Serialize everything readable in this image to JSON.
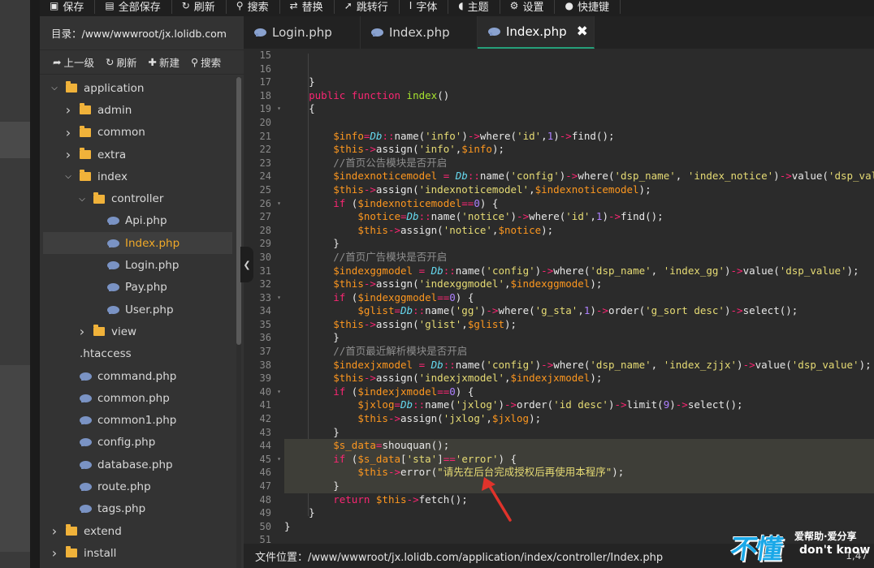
{
  "toolbar": {
    "buttons": [
      {
        "label": "保存",
        "icon": "save-icon"
      },
      {
        "label": "全部保存",
        "icon": "save-all-icon"
      },
      {
        "label": "刷新",
        "icon": "refresh-icon"
      },
      {
        "label": "搜索",
        "icon": "search-icon"
      },
      {
        "label": "替换",
        "icon": "replace-icon"
      },
      {
        "label": "跳转行",
        "icon": "goto-line-icon"
      },
      {
        "label": "字体",
        "icon": "font-icon"
      },
      {
        "label": "主题",
        "icon": "theme-icon"
      },
      {
        "label": "设置",
        "icon": "gear-icon"
      },
      {
        "label": "快捷键",
        "icon": "help-icon"
      }
    ]
  },
  "sidebar": {
    "directory": "目录：/www/wwwroot/jx.lolidb.com",
    "actions": {
      "up": "上一级",
      "refresh": "刷新",
      "new": "新建",
      "search": "搜索"
    },
    "tree": [
      {
        "label": "application",
        "type": "folder",
        "depth": 0,
        "open": true
      },
      {
        "label": "admin",
        "type": "folder",
        "depth": 1,
        "open": false
      },
      {
        "label": "common",
        "type": "folder",
        "depth": 1,
        "open": false
      },
      {
        "label": "extra",
        "type": "folder",
        "depth": 1,
        "open": false
      },
      {
        "label": "index",
        "type": "folder",
        "depth": 1,
        "open": true
      },
      {
        "label": "controller",
        "type": "folder",
        "depth": 2,
        "open": true
      },
      {
        "label": "Api.php",
        "type": "php",
        "depth": 3
      },
      {
        "label": "Index.php",
        "type": "php",
        "depth": 3,
        "selected": true
      },
      {
        "label": "Login.php",
        "type": "php",
        "depth": 3
      },
      {
        "label": "Pay.php",
        "type": "php",
        "depth": 3
      },
      {
        "label": "User.php",
        "type": "php",
        "depth": 3
      },
      {
        "label": "view",
        "type": "folder",
        "depth": 2,
        "open": false
      },
      {
        "label": ".htaccess",
        "type": "file",
        "depth": 1
      },
      {
        "label": "command.php",
        "type": "php",
        "depth": 1
      },
      {
        "label": "common.php",
        "type": "php",
        "depth": 1
      },
      {
        "label": "common1.php",
        "type": "php",
        "depth": 1
      },
      {
        "label": "config.php",
        "type": "php",
        "depth": 1
      },
      {
        "label": "database.php",
        "type": "php",
        "depth": 1
      },
      {
        "label": "route.php",
        "type": "php",
        "depth": 1
      },
      {
        "label": "tags.php",
        "type": "php",
        "depth": 1
      },
      {
        "label": "extend",
        "type": "folder",
        "depth": 0,
        "open": false
      },
      {
        "label": "install",
        "type": "folder",
        "depth": 0,
        "open": false
      }
    ]
  },
  "tabs": [
    {
      "label": "Login.php",
      "active": false
    },
    {
      "label": "Index.php",
      "active": false
    },
    {
      "label": "Index.php",
      "active": true
    }
  ],
  "editor": {
    "line_numbers": [
      "15",
      "16",
      "17",
      "18",
      "19",
      "20",
      "21",
      "22",
      "23",
      "24",
      "25",
      "26",
      "27",
      "28",
      "29",
      "30",
      "31",
      "32",
      "33",
      "34",
      "35",
      "36",
      "37",
      "38",
      "39",
      "40",
      "41",
      "42",
      "43",
      "44",
      "45",
      "46",
      "47",
      "48",
      "49",
      "50",
      "51"
    ],
    "fold_lines": [
      "19",
      "26",
      "33",
      "40",
      "45"
    ],
    "highlighted_lines": [
      "44",
      "45",
      "46",
      "47"
    ]
  },
  "status": {
    "path": "文件位置：/www/wwwroot/jx.lolidb.com/application/index/controller/Index.php",
    "position": "1,47"
  },
  "watermark": {
    "big": "不懂",
    "top": "爱帮助·爱分享",
    "bottom": "don't know"
  },
  "colors": {
    "accent_tab": "#26a07a",
    "selected_file": "#f0a928",
    "folder": "#f0b23a",
    "arrow": "#e0332b"
  }
}
